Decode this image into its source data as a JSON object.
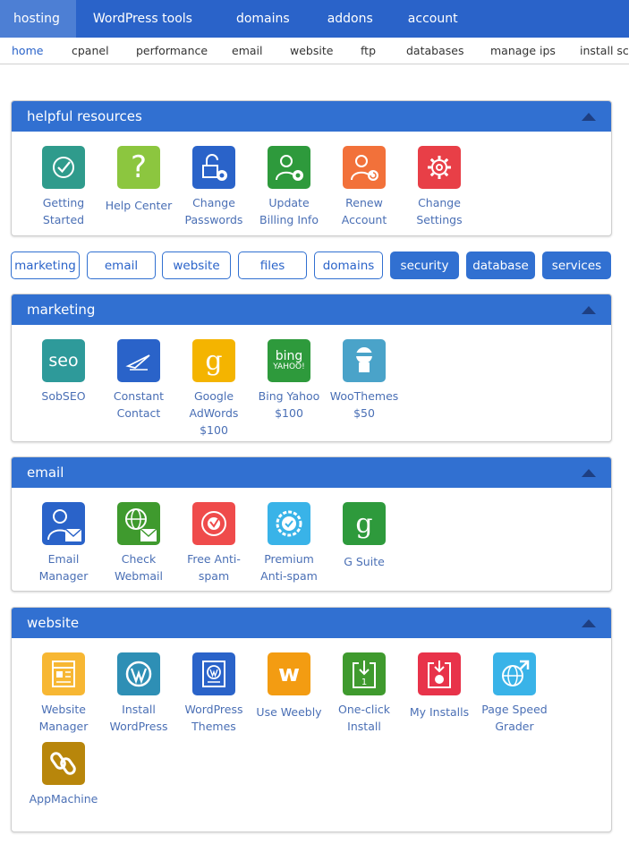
{
  "topnav": [
    "hosting",
    "WordPress tools",
    "domains",
    "addons",
    "account"
  ],
  "subnav": [
    "home",
    "cpanel",
    "performance",
    "email",
    "website",
    "ftp",
    "databases",
    "manage ips",
    "install scr"
  ],
  "resources": {
    "title": "helpful resources",
    "items": [
      {
        "label": "Getting Started",
        "color": "#2f9b8c"
      },
      {
        "label": "Help Center",
        "color": "#8cc63f"
      },
      {
        "label": "Change Passwords",
        "color": "#2a63c9"
      },
      {
        "label": "Update Billing Info",
        "color": "#2e9a3c"
      },
      {
        "label": "Renew Account",
        "color": "#f2713a"
      },
      {
        "label": "Change Settings",
        "color": "#e83f47"
      }
    ]
  },
  "filters": [
    "marketing",
    "email",
    "website",
    "files",
    "domains",
    "security",
    "database",
    "services"
  ],
  "marketing": {
    "title": "marketing",
    "items": [
      {
        "label": "SobSEO",
        "color": "#2e9a9a",
        "glyph": "seo"
      },
      {
        "label": "Constant Contact",
        "color": "#2a63c9"
      },
      {
        "label": "Google AdWords $100",
        "color": "#f4b400",
        "glyph": "g"
      },
      {
        "label": "Bing Yahoo $100",
        "color": "#2e9a3c",
        "glyph": "bing",
        "glyph2": "YAHOO!"
      },
      {
        "label": "WooThemes $50",
        "color": "#4aa3c9"
      }
    ]
  },
  "email": {
    "title": "email",
    "items": [
      {
        "label": "Email Manager",
        "color": "#2a63c9"
      },
      {
        "label": "Check Webmail",
        "color": "#3f9a2e"
      },
      {
        "label": "Free Anti-spam",
        "color": "#ef4b4b"
      },
      {
        "label": "Premium Anti-spam",
        "color": "#39b3e8"
      },
      {
        "label": "G Suite",
        "color": "#2e9a3c",
        "glyph": "g"
      }
    ]
  },
  "website": {
    "title": "website",
    "items": [
      {
        "label": "Website Manager",
        "color": "#f7b733"
      },
      {
        "label": "Install WordPress",
        "color": "#2e8fb5"
      },
      {
        "label": "WordPress Themes",
        "color": "#2a63c9"
      },
      {
        "label": "Use Weebly",
        "color": "#f39c12",
        "glyph": "w"
      },
      {
        "label": "One-click Install",
        "color": "#3f9a2e"
      },
      {
        "label": "My Installs",
        "color": "#e8334a"
      },
      {
        "label": "Page Speed Grader",
        "color": "#39b3e8"
      },
      {
        "label": "AppMachine",
        "color": "#b8860b"
      }
    ]
  }
}
